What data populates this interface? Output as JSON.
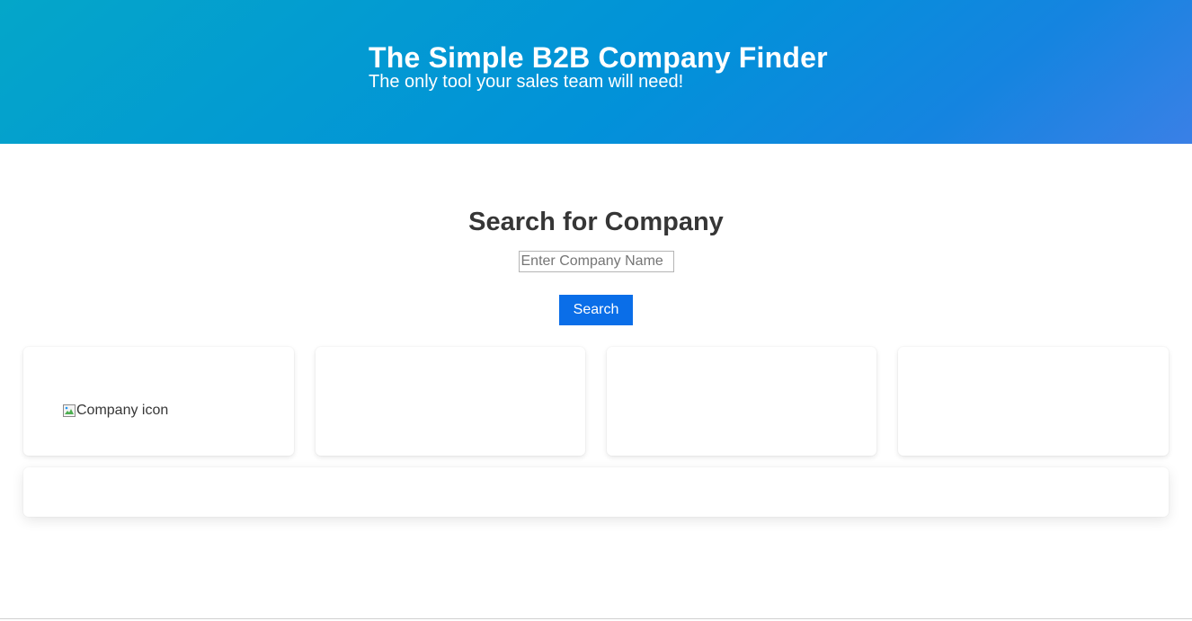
{
  "hero": {
    "title": "The Simple B2B Company Finder",
    "subtitle": "The only tool your sales team will need!"
  },
  "search": {
    "heading": "Search for Company",
    "input_placeholder": "Enter Company Name",
    "input_value": "",
    "button_label": "Search"
  },
  "results": {
    "company_icon_alt": "Company icon",
    "company_icon_name": "broken-image-icon"
  },
  "colors": {
    "hero_gradient_start": "#04a6c9",
    "hero_gradient_end": "#3a80e6",
    "button_bg": "#0a6ee8",
    "text": "#363636"
  }
}
